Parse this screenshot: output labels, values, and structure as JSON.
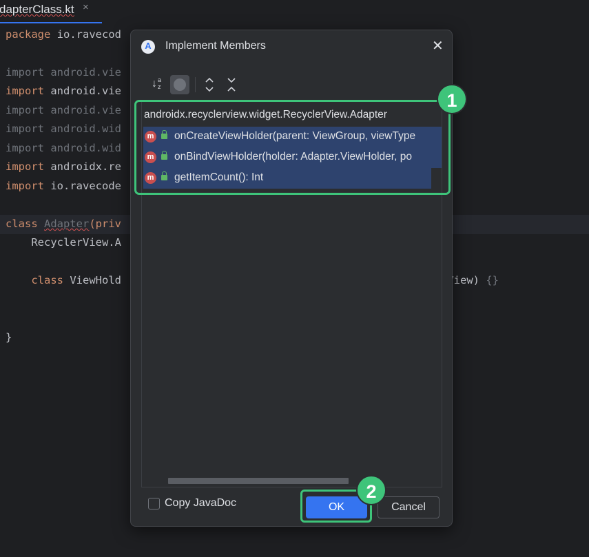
{
  "editor_tab": {
    "label": "dapterClass.kt",
    "close_glyph": "×"
  },
  "code": {
    "package_kw": "package",
    "package_name": " io.ravecod",
    "imports": [
      {
        "kw": "import",
        "path": " android.vie",
        "used": false
      },
      {
        "kw": "import",
        "path": " android.vie",
        "used": true
      },
      {
        "kw": "import",
        "path": " android.vie",
        "used": false
      },
      {
        "kw": "import",
        "path": " android.wid",
        "used": false
      },
      {
        "kw": "import",
        "path": " android.wid",
        "used": false
      },
      {
        "kw": "import",
        "path": " androidx.re",
        "used": true
      },
      {
        "kw": "import",
        "path": " io.ravecode",
        "used": true
      }
    ],
    "class_kw": "class",
    "class_name": "Adapter",
    "class_rest": "(priv",
    "super_line": "    RecyclerView.A",
    "inner_kw": "    class",
    "inner_rest": " ViewHold",
    "inner_tail": "mView) ",
    "inner_braces": "{}",
    "closing_brace": "}"
  },
  "dialog": {
    "title": "Implement Members",
    "logo_letter": "A",
    "close_glyph": "✕",
    "toolbar": {
      "sort_icon": "sort-alphabetically-icon",
      "toggle_icon": "show-classes-icon",
      "expand_icon": "expand-all-icon",
      "collapse_icon": "collapse-all-icon"
    },
    "tree": {
      "root": "androidx.recyclerview.widget.RecyclerView.Adapter",
      "members": [
        {
          "icon": "m",
          "label": "onCreateViewHolder(parent: ViewGroup, viewType"
        },
        {
          "icon": "m",
          "label": "onBindViewHolder(holder: Adapter.ViewHolder, po"
        },
        {
          "icon": "m",
          "label": "getItemCount(): Int"
        }
      ]
    },
    "copy_javadoc": {
      "label": "Copy JavaDoc",
      "checked": false
    },
    "ok_label": "OK",
    "cancel_label": "Cancel"
  },
  "annotations": {
    "badge1": "1",
    "badge2": "2",
    "highlight_color": "#3ec47a"
  },
  "colors": {
    "accent": "#3574f0",
    "selection": "#2e436e",
    "keyword": "#cf8e6d",
    "method_icon": "#c94f4f"
  }
}
